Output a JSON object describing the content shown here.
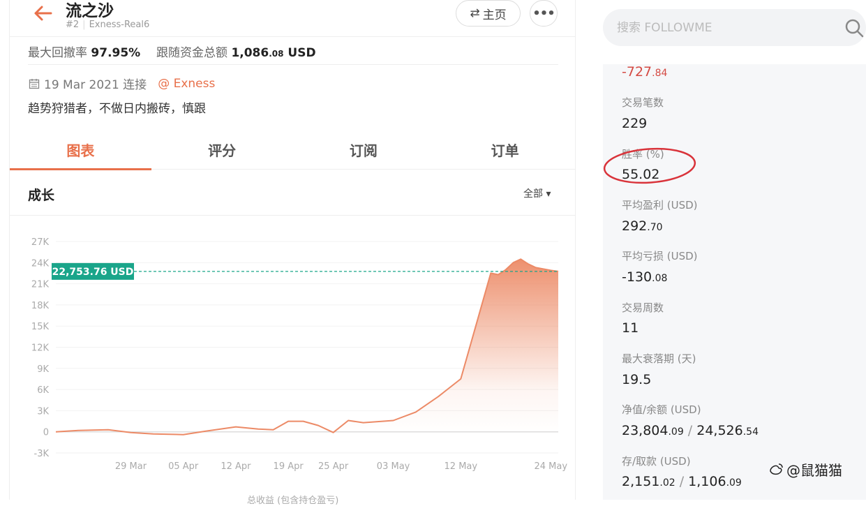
{
  "header": {
    "trader_name": "流之沙",
    "rank": "#2",
    "account": "Exness-Real6",
    "home_label": "主页",
    "more_label": "•••"
  },
  "summary": {
    "drawdown_label": "最大回撤率",
    "drawdown_value": "97.95%",
    "funds_label": "跟随资金总额",
    "funds_int": "1,086",
    "funds_dec": ".08",
    "funds_unit": "USD"
  },
  "meta": {
    "connect_date": "19 Mar 2021 连接",
    "broker": "@ Exness",
    "description": "趋势狩猎者，不做日内搬砖，慎跟"
  },
  "tabs": [
    "图表",
    "评分",
    "订阅",
    "订单"
  ],
  "growth": {
    "title": "成长",
    "range_label": "全部",
    "bottom_caption": "总收益 (包含持仓盈亏)"
  },
  "chart_data": {
    "type": "area",
    "yticks": [
      "27K",
      "24K",
      "21K",
      "18K",
      "15K",
      "12K",
      "9K",
      "6K",
      "3K",
      "0",
      "-3K"
    ],
    "ylim": [
      -3000,
      27000
    ],
    "xticks": [
      "29 Mar",
      "05 Apr",
      "12 Apr",
      "19 Apr",
      "25 Apr",
      "03 May",
      "12 May",
      "24 May"
    ],
    "current_label": "22,753.76 USD",
    "current_value": 22753.76,
    "line_color": "#ec8a66",
    "label_color": "#1aa58a",
    "series": [
      {
        "x": [
          "19 Mar",
          "22 Mar",
          "26 Mar",
          "29 Mar",
          "01 Apr",
          "05 Apr",
          "08 Apr",
          "12 Apr",
          "15 Apr",
          "17 Apr",
          "19 Apr",
          "21 Apr",
          "23 Apr",
          "25 Apr",
          "27 Apr",
          "29 Apr",
          "03 May",
          "06 May",
          "09 May",
          "12 May",
          "14 May",
          "16 May",
          "17 May",
          "18 May",
          "19 May",
          "20 May",
          "21 May",
          "22 May",
          "24 May",
          "25 May"
        ],
        "values": [
          0,
          200,
          300,
          -100,
          -300,
          -400,
          100,
          700,
          400,
          300,
          1500,
          1500,
          900,
          -100,
          1600,
          1300,
          1600,
          2800,
          5000,
          7500,
          15000,
          22500,
          22300,
          23000,
          24000,
          24500,
          23800,
          23300,
          22900,
          22753.76
        ]
      }
    ]
  },
  "stats": {
    "top_value_int": "-727",
    "top_value_dec": ".84",
    "trades_label": "交易笔数",
    "trades_value": "229",
    "winrate_label": "胜率 (%)",
    "winrate_value": "55.02",
    "avg_profit_label": "平均盈利 (USD)",
    "avg_profit_int": "292",
    "avg_profit_dec": ".70",
    "avg_loss_label": "平均亏损 (USD)",
    "avg_loss_int": "-130",
    "avg_loss_dec": ".08",
    "weeks_label": "交易周数",
    "weeks_value": "11",
    "max_dd_label": "最大衰落期 (天)",
    "max_dd_value": "19.5",
    "equity_label": "净值/余额 (USD)",
    "equity_int": "23,804",
    "equity_dec": ".09",
    "balance_int": "24,526",
    "balance_dec": ".54",
    "deposit_label": "存/取款 (USD)",
    "deposit_int": "2,151",
    "deposit_dec": ".02",
    "withdraw_int": "1,106",
    "withdraw_dec": ".09",
    "annotation_color": "#d9333a"
  },
  "search": {
    "placeholder": "搜索 FOLLOWME"
  },
  "watermark": "@鼠猫猫",
  "colors": {
    "accent": "#e8704a",
    "negative": "#d44a43"
  }
}
